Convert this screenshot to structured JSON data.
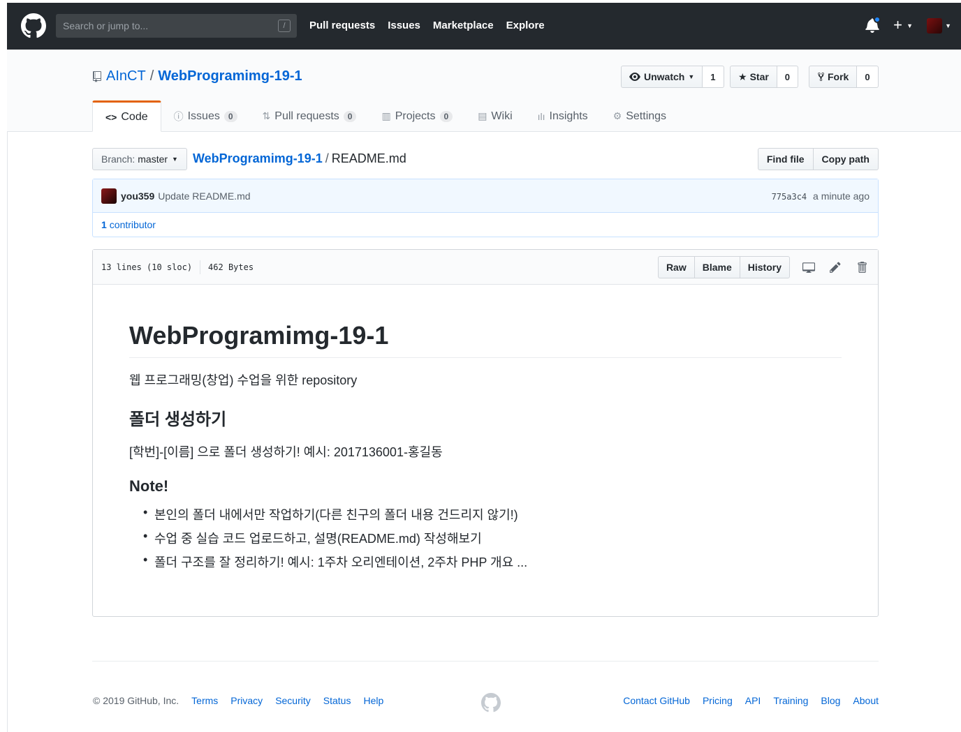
{
  "header": {
    "search_placeholder": "Search or jump to...",
    "slash_key": "/",
    "nav": [
      "Pull requests",
      "Issues",
      "Marketplace",
      "Explore"
    ],
    "plus_label": "+"
  },
  "repo": {
    "owner": "AInCT",
    "separator": "/",
    "name": "WebProgramimg-19-1",
    "watch_label": "Unwatch",
    "watch_count": "1",
    "star_label": "Star",
    "star_count": "0",
    "fork_label": "Fork",
    "fork_count": "0"
  },
  "tabs": [
    {
      "label": "Code",
      "icon": "<>"
    },
    {
      "label": "Issues",
      "count": "0"
    },
    {
      "label": "Pull requests",
      "count": "0"
    },
    {
      "label": "Projects",
      "count": "0"
    },
    {
      "label": "Wiki"
    },
    {
      "label": "Insights"
    },
    {
      "label": "Settings"
    }
  ],
  "filenav": {
    "branch_label": "Branch:",
    "branch": "master",
    "root": "WebProgramimg-19-1",
    "separator": "/",
    "filename": "README.md",
    "find_file": "Find file",
    "copy_path": "Copy path"
  },
  "commit": {
    "author": "you359",
    "message": "Update README.md",
    "sha": "775a3c4",
    "time": "a minute ago",
    "contributors_num": "1",
    "contributors_label": "contributor"
  },
  "file": {
    "lines": "13 lines (10 sloc)",
    "size": "462 Bytes",
    "raw": "Raw",
    "blame": "Blame",
    "history": "History"
  },
  "readme": {
    "h1": "WebProgramimg-19-1",
    "intro": "웹 프로그래밍(창업) 수업을 위한 repository",
    "h2": "폴더 생성하기",
    "folder_rule": "[학번]-[이름] 으로 폴더 생성하기! 예시: 2017136001-홍길동",
    "h3": "Note!",
    "notes": [
      "본인의 폴더 내에서만 작업하기(다른 친구의 폴더 내용 건드리지 않기!)",
      "수업 중 실습 코드 업로드하고, 설명(README.md) 작성해보기",
      "폴더 구조를 잘 정리하기! 예시: 1주차 오리엔테이션, 2주차 PHP 개요 ..."
    ]
  },
  "footer": {
    "copyright": "© 2019 GitHub, Inc.",
    "left_links": [
      "Terms",
      "Privacy",
      "Security",
      "Status",
      "Help"
    ],
    "right_links": [
      "Contact GitHub",
      "Pricing",
      "API",
      "Training",
      "Blog",
      "About"
    ]
  },
  "colors": {
    "header_bg": "#24292e",
    "link": "#0366d6",
    "tab_accent": "#e36209",
    "commit_bg": "#f1f8ff"
  }
}
